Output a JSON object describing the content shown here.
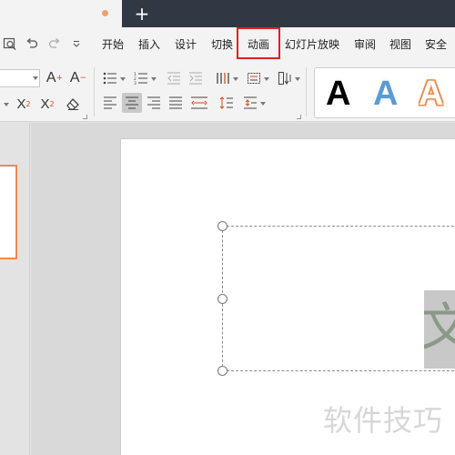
{
  "window": {
    "new_tab_symbol": "+",
    "active_tab_dot_color": "#f0a070"
  },
  "quick_access": [
    {
      "name": "print-preview-icon"
    },
    {
      "name": "undo-icon"
    },
    {
      "name": "redo-icon"
    },
    {
      "name": "customize-dropdown-icon"
    }
  ],
  "menu": {
    "items": [
      "开始",
      "插入",
      "设计",
      "切换",
      "动画",
      "幻灯片放映",
      "审阅",
      "视图",
      "安全"
    ],
    "highlighted_index": 4,
    "highlight_color": "#e02020"
  },
  "ribbon": {
    "font_size_value": "",
    "font_buttons": {
      "increase": "A",
      "decrease": "A",
      "superscript": "X",
      "superscript_mark": "2",
      "subscript": "X",
      "subscript_mark": "2"
    },
    "paragraph_icons": [
      "bullets-icon",
      "numbering-icon",
      "decrease-indent-icon",
      "increase-indent-icon",
      "column-icon",
      "text-box-icon",
      "text-direction-icon",
      "align-left-icon",
      "align-center-icon",
      "align-right-icon",
      "justify-icon",
      "distribute-icon",
      "line-spacing-icon",
      "paragraph-spacing-icon"
    ],
    "active_alignment": "align-center",
    "text_styles": [
      {
        "letter": "A",
        "fill": "#000000",
        "outline": "#ffffff"
      },
      {
        "letter": "A",
        "fill": "#5b9bd5",
        "outline": "#ffffff"
      },
      {
        "letter": "A",
        "fill": "#ffffff",
        "outline": "#ed8c4b"
      }
    ]
  },
  "slide": {
    "wordart_char": "文",
    "watermark_text": "软件技巧"
  },
  "colors": {
    "titlebar": "#2f3843",
    "ribbon_bg": "#f3f3f3",
    "selected_thumb_border": "#f08a4b"
  }
}
